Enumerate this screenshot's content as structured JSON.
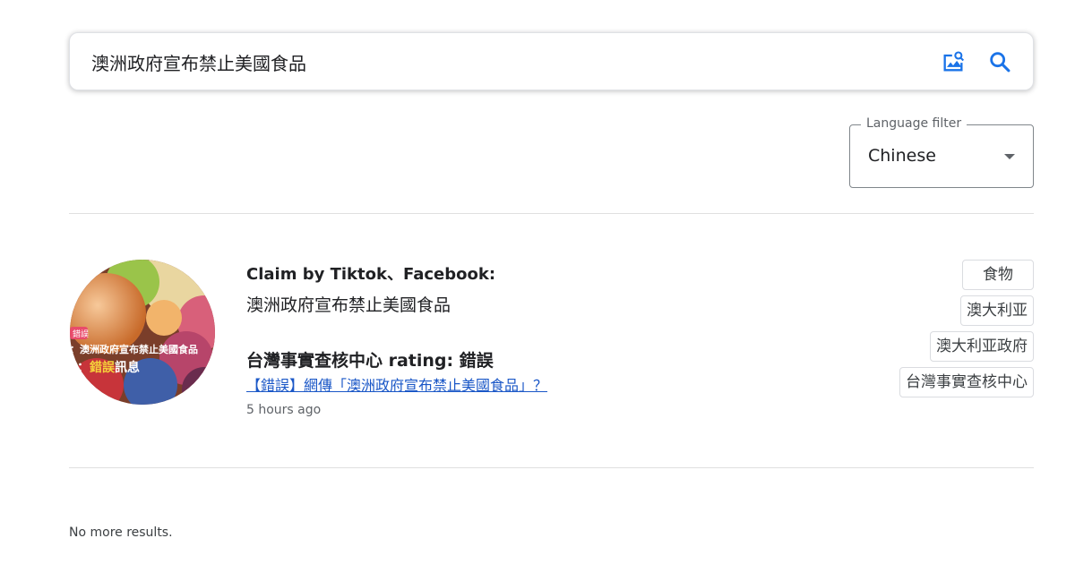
{
  "search": {
    "query": "澳洲政府宣布禁止美國食品"
  },
  "language_filter": {
    "label": "Language filter",
    "value": "Chinese"
  },
  "result": {
    "claim_header": "Claim by Tiktok、Facebook:",
    "claim_text": "澳洲政府宣布禁止美國食品",
    "rating_line": "台灣事實查核中心 rating: 錯誤",
    "review_link": "【錯誤】網傳「澳洲政府宣布禁止美國食品」？",
    "timestamp": "5 hours ago",
    "thumbnail_badge": "錯誤",
    "thumbnail_line1": "：澳洲政府宣布禁止美國食品",
    "thumbnail_line2_highlight": "錯誤",
    "thumbnail_line2_rest": "訊息",
    "tags": [
      "食物",
      "澳大利亚",
      "澳大利亚政府",
      "台灣事實查核中心"
    ]
  },
  "footer": {
    "no_more": "No more results."
  },
  "colors": {
    "accent_blue": "#1a73e8",
    "link": "#1a57c7"
  }
}
